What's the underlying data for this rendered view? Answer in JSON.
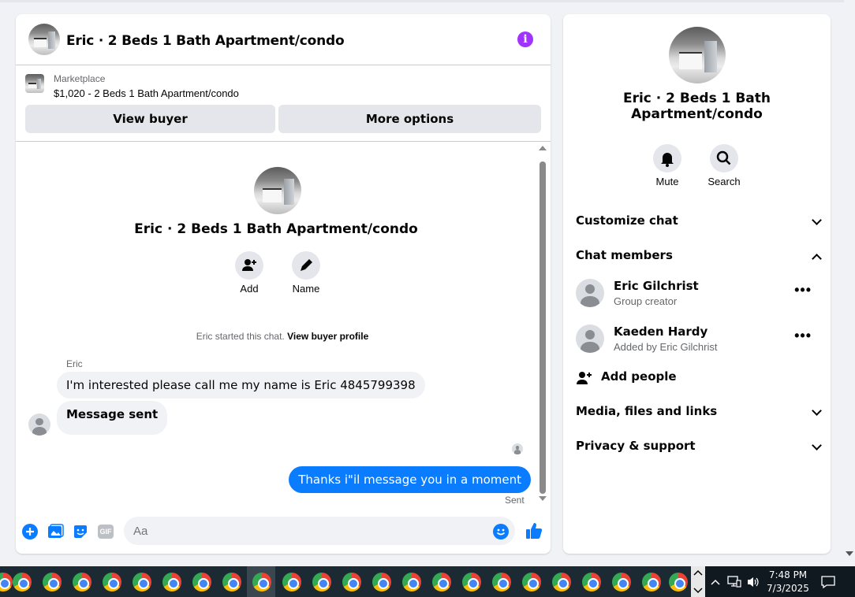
{
  "chat": {
    "title": "Eric · 2 Beds 1 Bath Apartment/condo",
    "marketplace_label": "Marketplace",
    "listing": "$1,020 - 2 Beds 1 Bath Apartment/condo",
    "view_buyer": "View buyer",
    "more_options": "More options",
    "intro_title": "Eric · 2 Beds 1 Bath Apartment/condo",
    "add_label": "Add",
    "name_label": "Name",
    "system_text": "Eric started this chat.",
    "system_link": "View buyer profile",
    "sender": "Eric",
    "message_1": "I'm interested  please call me my name is Eric 4845799398",
    "message_2": "Message sent",
    "outgoing": "Thanks i\"il message you in a moment",
    "sent_status": "Sent",
    "input_placeholder": "Aa",
    "gif_label": "GIF"
  },
  "panel": {
    "title": "Eric · 2 Beds 1 Bath Apartment/condo",
    "mute": "Mute",
    "search": "Search",
    "customize": "Customize chat",
    "members_header": "Chat members",
    "members": [
      {
        "name": "Eric Gilchrist",
        "sub": "Group creator"
      },
      {
        "name": "Kaeden Hardy",
        "sub": "Added by Eric Gilchrist"
      }
    ],
    "add_people": "Add people",
    "media": "Media, files and links",
    "privacy": "Privacy & support"
  },
  "taskbar": {
    "time": "7:48 PM",
    "date": "7/3/2025"
  },
  "colors": {
    "accent": "#0a7cff",
    "info": "#a033ff",
    "bubble_in": "#f0f2f5"
  }
}
